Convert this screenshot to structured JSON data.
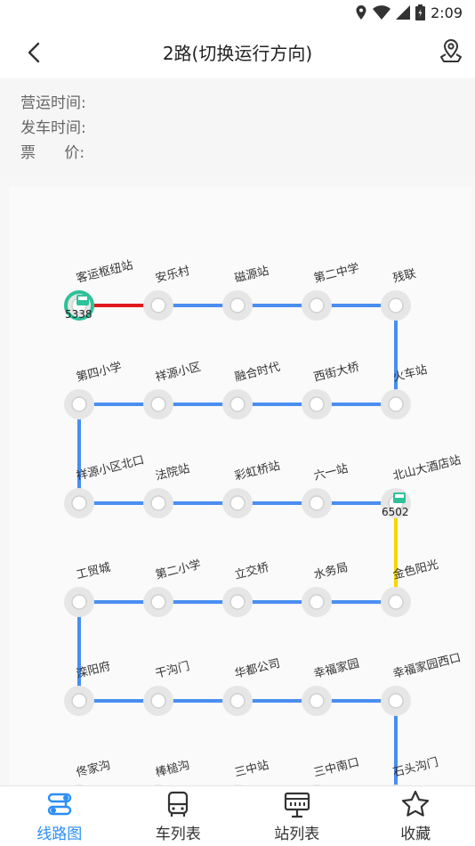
{
  "status": {
    "time": "2:09"
  },
  "header": {
    "title": "2路(切换运行方向)",
    "back_icon": "chevron-left-icon",
    "location_icon": "map-pin-icon"
  },
  "info": [
    {
      "label": "营运时间:",
      "value": ""
    },
    {
      "label": "发车时间:",
      "value": ""
    },
    {
      "label": "票      价:",
      "value": ""
    }
  ],
  "colors": {
    "line": "#4a8ef0",
    "active": "#e0191f",
    "yellow": "#f5d700",
    "bus": "#2ec19a",
    "stop": "#e6e6e6",
    "accent": "#2a8ef6"
  },
  "stops": [
    "客运枢纽站",
    "安乐村",
    "磁源站",
    "第二中学",
    "残联",
    "火车站",
    "西街大桥",
    "融合时代",
    "祥源小区",
    "第四小学",
    "祥源小区北口",
    "法院站",
    "彩虹桥站",
    "六一站",
    "北山大酒店站",
    "金色阳光",
    "水务局",
    "立交桥",
    "第二小学",
    "工贸城",
    "滦阳府",
    "干沟门",
    "华都公司",
    "幸福家园",
    "幸福家园西口",
    "石头沟门",
    "三中南口",
    "三中站",
    "棒槌沟",
    "佟家沟"
  ],
  "buses": [
    {
      "plate": "5338",
      "stop_index": 0
    },
    {
      "plate": "6502",
      "stop_index": 14
    }
  ],
  "tabs": [
    {
      "label": "线路图",
      "icon": "route-map-icon",
      "active": true
    },
    {
      "label": "车列表",
      "icon": "bus-icon",
      "active": false
    },
    {
      "label": "站列表",
      "icon": "station-board-icon",
      "active": false
    },
    {
      "label": "收藏",
      "icon": "star-icon",
      "active": false
    }
  ]
}
